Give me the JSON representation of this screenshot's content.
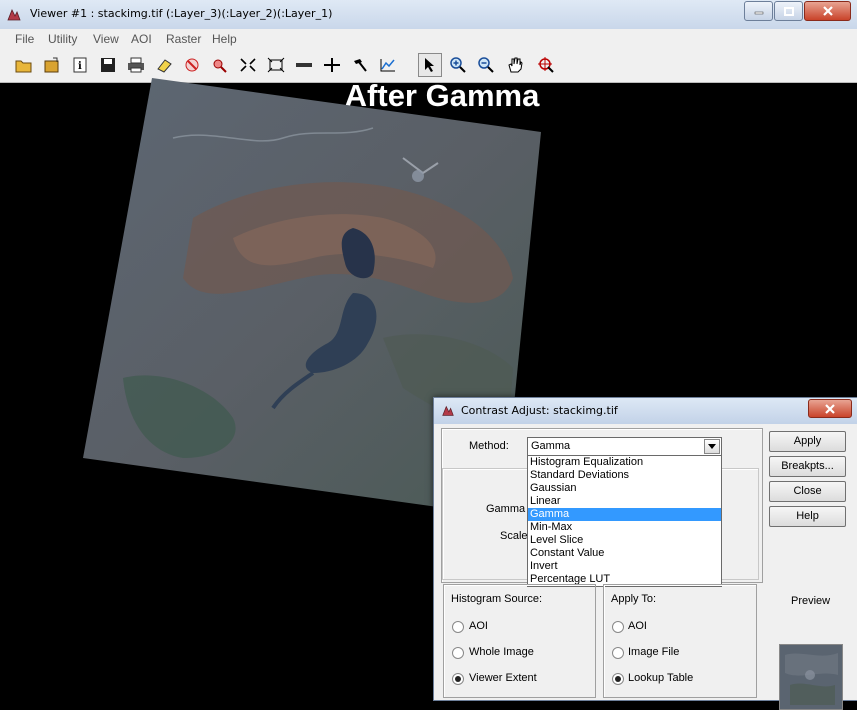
{
  "window": {
    "title": "Viewer #1 : stackimg.tif (:Layer_3)(:Layer_2)(:Layer_1)"
  },
  "menu": [
    "File",
    "Utility",
    "View",
    "AOI",
    "Raster",
    "Help"
  ],
  "toolbar": {
    "icons": [
      "open-icon",
      "new-icon",
      "info-icon",
      "save-icon",
      "print-icon",
      "eraser-icon",
      "clear-icon",
      "inquire-icon",
      "fit-icon",
      "scale-icon",
      "measure-icon",
      "crosshair-icon",
      "hammer-icon",
      "profile-icon",
      "select-arrow-icon",
      "zoom-in-icon",
      "zoom-out-icon",
      "pan-hand-icon",
      "roam-icon"
    ],
    "selected_tool": "select-arrow-icon"
  },
  "viewer": {
    "heading": "After Gamma"
  },
  "dialog": {
    "title": "Contrast Adjust: stackimg.tif",
    "method_label": "Method:",
    "method_value": "Gamma",
    "method_options": [
      "Histogram Equalization",
      "Standard Deviations",
      "Gaussian",
      "Linear",
      "Gamma",
      "Min-Max",
      "Level Slice",
      "Constant Value",
      "Invert",
      "Percentage LUT"
    ],
    "selected_option": "Gamma",
    "gamma_label": "Gamma",
    "scale_label": "Scale",
    "buttons": {
      "apply": "Apply",
      "breakpts": "Breakpts...",
      "close": "Close",
      "help": "Help"
    },
    "histogram_source": {
      "label": "Histogram Source:",
      "options": [
        "AOI",
        "Whole Image",
        "Viewer Extent"
      ],
      "selected": "Viewer Extent"
    },
    "apply_to": {
      "label": "Apply To:",
      "options": [
        "AOI",
        "Image File",
        "Lookup Table"
      ],
      "selected": "Lookup Table"
    },
    "preview_label": "Preview"
  },
  "colors": {
    "selection": "#3399ff",
    "title_bar": "#c9d7ea",
    "close_button": "#c9432a"
  }
}
